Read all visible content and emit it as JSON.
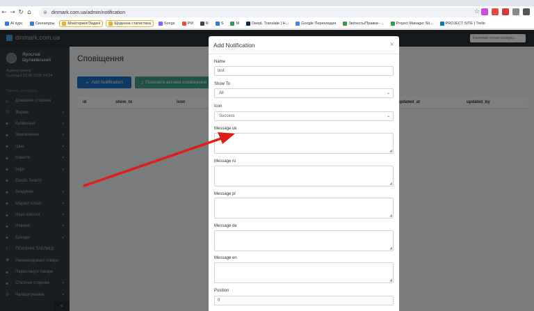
{
  "browser": {
    "url": "dinmark.com.ua/admin/notification",
    "bookmarks": [
      {
        "label": "AI курс",
        "color": "#2a7be4",
        "pill": false
      },
      {
        "label": "Сингапуры",
        "color": "#2a7be4",
        "pill": false
      },
      {
        "label": "Моніторинг/Задачі",
        "color": "#e2b340",
        "pill": true
      },
      {
        "label": "Щоденна статистика",
        "color": "#e2b340",
        "pill": true
      },
      {
        "label": "Songs",
        "color": "#8b5cf6",
        "pill": false
      },
      {
        "label": "PM",
        "color": "#e24c3a",
        "pill": false
      },
      {
        "label": "R",
        "color": "#444",
        "pill": false
      },
      {
        "label": "S",
        "color": "#2a7be4",
        "pill": false
      },
      {
        "label": "M",
        "color": "#2d9c4f",
        "pill": false
      },
      {
        "label": "DeepL Translate | Н...",
        "color": "#0f2b46",
        "pill": false
      },
      {
        "label": "Google Перекладач",
        "color": "#4285f4",
        "pill": false
      },
      {
        "label": "Звітність/Правки -...",
        "color": "#2d9c4f",
        "pill": false
      },
      {
        "label": "Project Manager Sit...",
        "color": "#2d9c4f",
        "pill": false
      },
      {
        "label": "PROJECT SITE | Trello",
        "color": "#0079bf",
        "pill": false
      }
    ]
  },
  "app": {
    "logo": "dinmark.com.ua",
    "search_placeholder": "Ключове слово пошуку..."
  },
  "sidebar": {
    "user_name": "Ярослав Щупаківський",
    "user_role": "Адміністратор",
    "user_date": "Сьогодні 23.09.2025 14:04",
    "section": "Панель контролю",
    "items": [
      {
        "label": "Домашня сторінка",
        "icon": "home-icon",
        "glyph": "⌂",
        "chev": false
      },
      {
        "label": "Форми",
        "icon": "list-icon",
        "glyph": "☰",
        "chev": true
      },
      {
        "label": "Купівельні",
        "icon": "cart-icon",
        "glyph": "▪",
        "chev": true
      },
      {
        "label": "Замовлення",
        "icon": "order-icon",
        "glyph": "▪",
        "chev": true
      },
      {
        "label": "Ціна",
        "icon": "price-icon",
        "glyph": "▪",
        "chev": true
      },
      {
        "label": "Клієнти",
        "icon": "clients-icon",
        "glyph": "▪",
        "chev": true
      },
      {
        "label": "Інфо",
        "icon": "info-icon",
        "glyph": "▪",
        "chev": true
      },
      {
        "label": "Elastic Search",
        "icon": "search-icon",
        "glyph": "▪",
        "chev": false
      },
      {
        "label": "Академія",
        "icon": "academy-icon",
        "glyph": "▪",
        "chev": true
      },
      {
        "label": "Маркет плейс",
        "icon": "market-icon",
        "glyph": "▪",
        "chev": true
      },
      {
        "label": "Наші клієнти",
        "icon": "users-icon",
        "glyph": "▪",
        "chev": true
      },
      {
        "label": "Новини",
        "icon": "news-icon",
        "glyph": "▪",
        "chev": true
      },
      {
        "label": "Бренди",
        "icon": "brand-icon",
        "glyph": "▪",
        "chev": true
      },
      {
        "label": "ТЕХНІЧНІ ТАБЛИЦІ",
        "icon": "question-icon",
        "glyph": "?",
        "chev": false
      },
      {
        "label": "Рекомендовані товари",
        "icon": "heart-icon",
        "glyph": "♥",
        "chev": false
      },
      {
        "label": "Переглянуті товари",
        "icon": "eye-icon",
        "glyph": "▪",
        "chev": false
      },
      {
        "label": "Статичні сторінки",
        "icon": "page-icon",
        "glyph": "▪",
        "chev": true
      },
      {
        "label": "Налаштування",
        "icon": "gear-icon",
        "glyph": "⚙",
        "chev": true
      }
    ]
  },
  "main": {
    "title": "Сповіщення",
    "add_button": "Add Notification",
    "active_button": "Показати активні сповіщення",
    "columns": [
      "id",
      "show_to",
      "icon",
      "updated_at",
      "updated_by"
    ]
  },
  "modal": {
    "title": "Add Notification",
    "close": "×",
    "fields": {
      "name_label": "Name",
      "name_value": "test",
      "show_to_label": "Show To",
      "show_to_value": "All",
      "icon_label": "Icon",
      "icon_value": "Success",
      "msg_uk_label": "Message uk",
      "msg_ru_label": "Message ru",
      "msg_pl_label": "Message pl",
      "msg_de_label": "Message de",
      "msg_en_label": "Message en",
      "position_label": "Position",
      "position_value": "0"
    }
  },
  "colors": {
    "annotation_arrow": "#e01b1b",
    "primary_button": "#1a73c8",
    "teal_button": "#3ea28f"
  }
}
